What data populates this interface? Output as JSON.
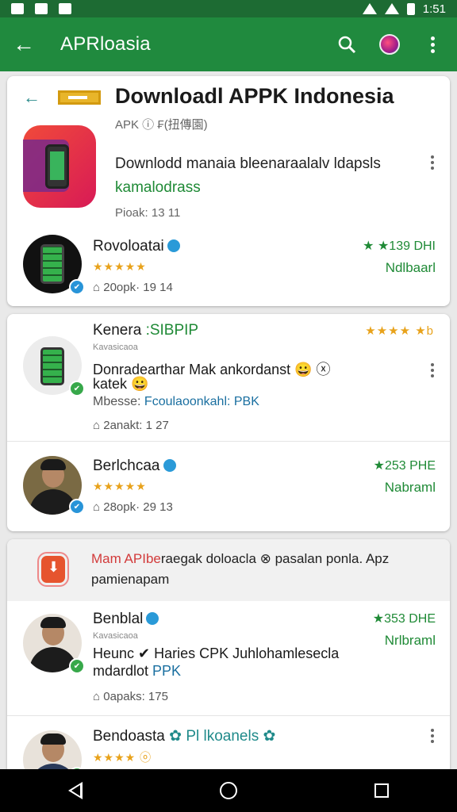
{
  "status": {
    "time": "1:51"
  },
  "appbar": {
    "title": "APRloasia",
    "back_icon": "arrow-left-icon",
    "search_icon": "search-icon",
    "profile_icon": "globe-icon",
    "menu_icon": "more-vert-icon"
  },
  "header_card": {
    "title": "Downloadl APPK Indonesia",
    "meta": "APK ⓘ  ₣(扭傳園)",
    "hero": {
      "description_1": "Downlodd manaia bleenaraalalv ldapsls",
      "description_2": "kamalodrass",
      "size": "Pioak: 13 11"
    },
    "row1": {
      "name": "Rovoloatai",
      "stars": "★★★★★",
      "meta": "⌂ 20opk· 19 14",
      "rating": "★ ★139 DHI",
      "action": "Ndlbaarl"
    }
  },
  "card2": {
    "row1": {
      "name": "Kenera",
      "tag": ":SIBPIP",
      "small": "Kavasicaoa",
      "desc_1": "Donradearthar Mak ankordanst 😀 ⓧ",
      "desc_2": "katek 😀",
      "desc_3_label": "Mbesse: ",
      "desc_3_link": "Fcoulaoonkahl: PBK",
      "meta": "⌂ 2anakt: 1 27",
      "stars": "★★★★ ★b"
    },
    "row2": {
      "name": "Berlchcaa",
      "stars": "★★★★★",
      "meta": "⌂ 28opk· 29 13",
      "rating": "★253 PHE",
      "action": "Nabraml"
    }
  },
  "card3": {
    "promo": {
      "text_red": "Mam APIbe",
      "text_rest": "raegak doloacla ⊗ pasalan ponla. Apz pamienapam"
    },
    "row1": {
      "name": "Benblal",
      "small": "Kavasicaoa",
      "desc_1": "Heunc ✔ Haries CPK Juhlohamlesecla",
      "desc_2_label": "mdardlot ",
      "desc_2_link": "PPK",
      "meta": "⌂ 0apaks: 175",
      "rating": "★353 DHE",
      "action": "Nrlbraml"
    },
    "row2": {
      "name": "Bendoasta",
      "tag": "✿ Pl lkoanels ✿",
      "stars": "★★★★ ⓞ"
    }
  },
  "colors": {
    "appbar": "#208a3e",
    "status": "#1d6b33",
    "accent_green": "#1f8a36",
    "star": "#e8a21b",
    "promo_red": "#d23a3a"
  }
}
